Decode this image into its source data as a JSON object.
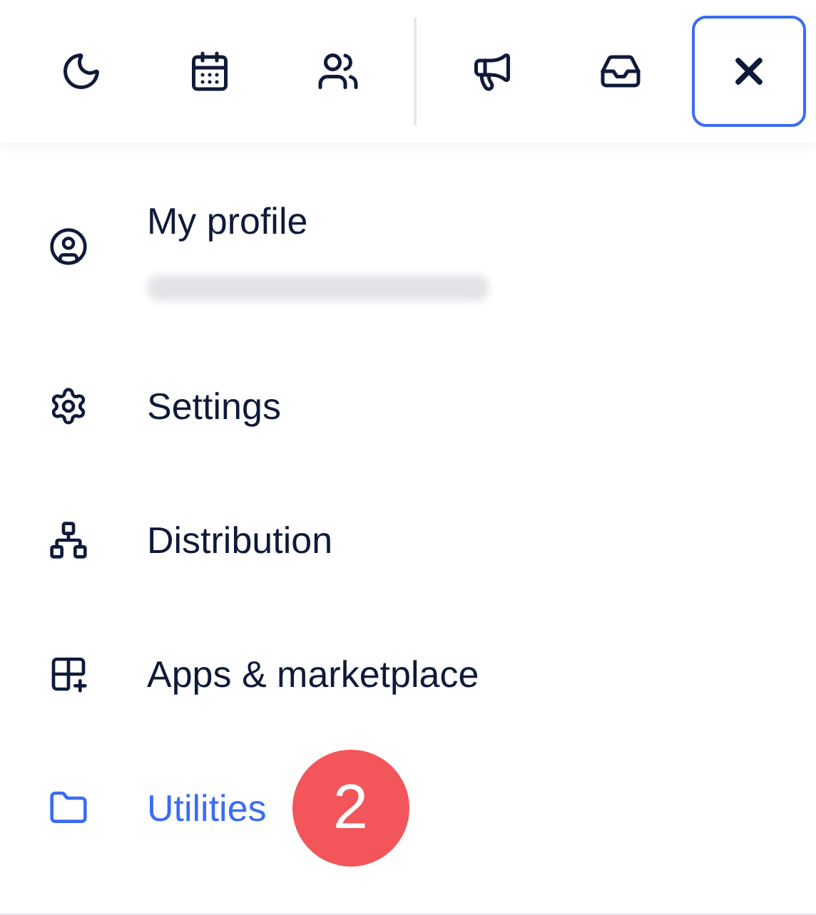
{
  "toolbar": {
    "buttons": [
      {
        "kind": "moon",
        "selected": false
      },
      {
        "kind": "calendar",
        "selected": false
      },
      {
        "kind": "users",
        "selected": false
      },
      {
        "kind": "divider"
      },
      {
        "kind": "megaphone",
        "selected": false
      },
      {
        "kind": "inbox",
        "selected": false
      },
      {
        "kind": "close",
        "selected": true
      }
    ]
  },
  "menu": {
    "items": [
      {
        "kind": "profile",
        "label": "My profile",
        "selected": false
      },
      {
        "kind": "settings",
        "label": "Settings",
        "selected": false
      },
      {
        "kind": "distribution",
        "label": "Distribution",
        "selected": false
      },
      {
        "kind": "apps",
        "label": "Apps & marketplace",
        "selected": false
      },
      {
        "kind": "utilities",
        "label": "Utilities",
        "selected": true,
        "badge": "2"
      }
    ]
  }
}
